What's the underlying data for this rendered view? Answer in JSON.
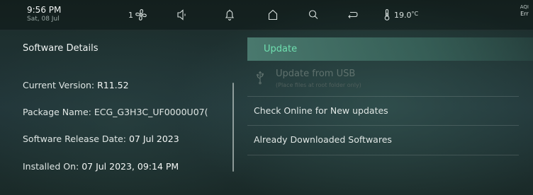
{
  "status_bar": {
    "time": "9:56 PM",
    "date": "Sat, 08 Jul",
    "fan_speed": "1",
    "temperature": "19.0",
    "temperature_unit": "°C",
    "aqi_label": "AQI",
    "aqi_value": "Err",
    "icons": [
      "fan-icon",
      "volume-icon",
      "bell-icon",
      "home-icon",
      "search-icon",
      "return-icon",
      "thermometer-icon"
    ]
  },
  "software_details": {
    "title": "Software Details",
    "current_version_label": "Current Version: ",
    "current_version_value": "R11.52",
    "package_name_label": "Package Name: ",
    "package_name_value": "ECG_G3H3C_UF0000U07(",
    "release_date_label": "Software Release Date: ",
    "release_date_value": "07 Jul 2023",
    "installed_on_label": "Installed On: ",
    "installed_on_value": "07 Jul 2023, 09:14 PM"
  },
  "update_menu": {
    "header": "Update",
    "update_from_usb": "Update from USB",
    "update_from_usb_hint": "(Place files at root folder only)",
    "check_online": "Check Online for New updates",
    "already_downloaded": "Already Downloaded Softwares"
  },
  "colors": {
    "accent": "#6fe0b0",
    "background": "#1c2c29",
    "active_row": "#4e8074",
    "disabled_text": "#5f716d"
  }
}
